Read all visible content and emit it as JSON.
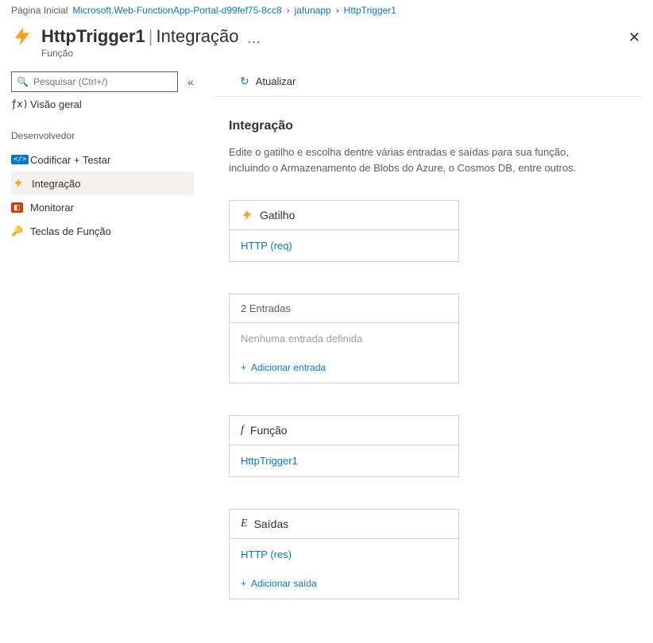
{
  "breadcrumb": {
    "home": "Página Inicial",
    "items": [
      "Microsoft.Web-FunctionApp-Portal-d99fef75-8cc8",
      "jafunapp",
      "HttpTrigger1"
    ]
  },
  "header": {
    "name": "HttpTrigger1",
    "mode": "Integração",
    "subtitle": "Função"
  },
  "search": {
    "placeholder": "Pesquisar (Ctrl+/)"
  },
  "sidebar": {
    "overview": "Visão geral",
    "group": "Desenvolvedor",
    "items": [
      {
        "label": "Codificar + Testar"
      },
      {
        "label": "Integração"
      },
      {
        "label": "Monitorar"
      },
      {
        "label": "Teclas de Função"
      }
    ]
  },
  "toolbar": {
    "refresh": "Atualizar"
  },
  "content": {
    "title": "Integração",
    "desc": "Edite o gatilho e escolha dentre várias entradas e saídas para sua função, incluindo o Armazenamento de Blobs do Azure, o Cosmos DB, entre outros."
  },
  "cards": {
    "trigger": {
      "title": "Gatilho",
      "link": "HTTP (req)"
    },
    "inputs": {
      "title": "2 Entradas",
      "empty": "Nenhuma entrada definida",
      "add": "Adicionar entrada"
    },
    "function": {
      "title_prefix": "f",
      "title": "Função",
      "link": "HttpTrigger1"
    },
    "outputs": {
      "title_prefix": "E",
      "title": "Saídas",
      "link": "HTTP (res)",
      "add": "Adicionar saída"
    }
  }
}
